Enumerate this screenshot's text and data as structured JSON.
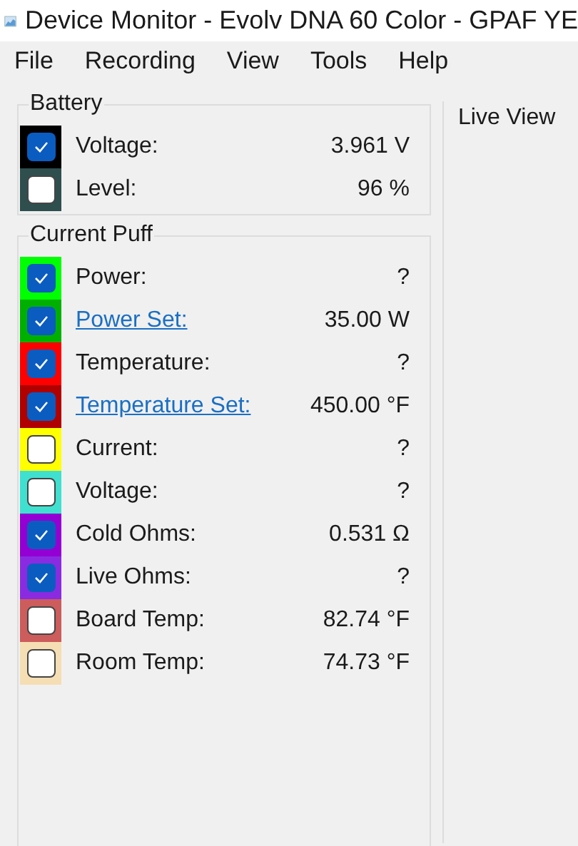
{
  "window": {
    "title": "Device Monitor - Evolv DNA 60 Color - GPAF YE"
  },
  "menu": [
    "File",
    "Recording",
    "View",
    "Tools",
    "Help"
  ],
  "battery": {
    "title": "Battery",
    "rows": [
      {
        "label": "Voltage:",
        "value": "3.961 V",
        "checked": true,
        "color": "#000000",
        "kind": "text"
      },
      {
        "label": "Level:",
        "value": "96 %",
        "checked": false,
        "color": "#2f4f4f",
        "kind": "text"
      }
    ]
  },
  "current_puff": {
    "title": "Current Puff",
    "rows": [
      {
        "label": "Power:",
        "value": "?",
        "checked": true,
        "color": "#00ff00",
        "kind": "text"
      },
      {
        "label": "Power Set:",
        "value": "35.00 W",
        "checked": true,
        "color": "#00b000",
        "kind": "link"
      },
      {
        "label": "Temperature:",
        "value": "?",
        "checked": true,
        "color": "#ff0000",
        "kind": "text"
      },
      {
        "label": "Temperature Set:",
        "value": "450.00 °F",
        "checked": true,
        "color": "#b00000",
        "kind": "link"
      },
      {
        "label": "Current:",
        "value": "?",
        "checked": false,
        "color": "#ffff00",
        "kind": "text"
      },
      {
        "label": "Voltage:",
        "value": "?",
        "checked": false,
        "color": "#40e0d0",
        "kind": "text"
      },
      {
        "label": "Cold Ohms:",
        "value": "0.531 Ω",
        "checked": true,
        "color": "#9400d3",
        "kind": "text"
      },
      {
        "label": "Live Ohms:",
        "value": "?",
        "checked": true,
        "color": "#8a2be2",
        "kind": "text"
      },
      {
        "label": "Board Temp:",
        "value": "82.74 °F",
        "checked": false,
        "color": "#cd5c5c",
        "kind": "text"
      },
      {
        "label": "Room Temp:",
        "value": "74.73 °F",
        "checked": false,
        "color": "#f5deb3",
        "kind": "text"
      }
    ]
  },
  "live_view": {
    "title": "Live View"
  }
}
